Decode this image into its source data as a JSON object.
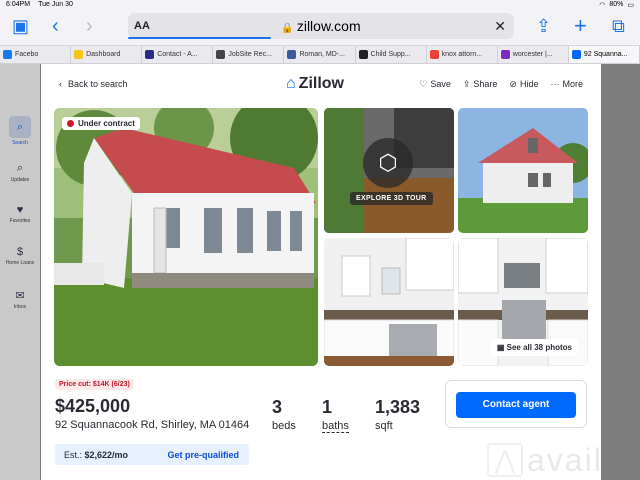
{
  "status_bar": {
    "time": "6:04PM",
    "date": "Tue Jun 30",
    "battery": "80%"
  },
  "browser": {
    "reader_label": "AA",
    "url": "zillow.com",
    "load_progress": 0.37,
    "tabs": [
      {
        "label": "Facebo",
        "color": "#1877f2"
      },
      {
        "label": "Dashboard",
        "color": "#f5c518"
      },
      {
        "label": "Contact - A...",
        "color": "#2a2a8a"
      },
      {
        "label": "JobSite Rec...",
        "color": "#444444"
      },
      {
        "label": "Roman, MD-...",
        "color": "#3b5998"
      },
      {
        "label": "Child Supp...",
        "color": "#222222"
      },
      {
        "label": "knox attorn...",
        "color": "#ea4335"
      },
      {
        "label": "worcester |...",
        "color": "#7b2cbf"
      },
      {
        "label": "92 Squanna...",
        "color": "#006aff"
      }
    ]
  },
  "sidebar": {
    "items": [
      {
        "label": "Search",
        "icon": "search-icon"
      },
      {
        "label": "Updates",
        "icon": "updates-icon"
      },
      {
        "label": "Favorites",
        "icon": "heart-icon"
      },
      {
        "label": "Home Loans",
        "icon": "home-loans-icon"
      },
      {
        "label": "Inbox",
        "icon": "inbox-icon"
      }
    ]
  },
  "listing": {
    "back_label": "Back to search",
    "logo_text": "Zillow",
    "actions": {
      "save": "Save",
      "share": "Share",
      "hide": "Hide",
      "more": "More"
    },
    "status_badge": "Under contract",
    "tour_label": "EXPLORE 3D TOUR",
    "see_all": "See all 38 photos",
    "price_cut": "Price cut: $14K (6/23)",
    "price": "$425,000",
    "address": "92 Squannacook Rd, Shirley, MA 01464",
    "beds_value": "3",
    "beds_label": "beds",
    "baths_value": "1",
    "baths_label": "baths",
    "sqft_value": "1,383",
    "sqft_label": "sqft",
    "est_label": "Est.:",
    "est_value": "$2,622/mo",
    "prequal": "Get pre-qualified",
    "contact_agent": "Contact agent"
  },
  "watermark": "avail",
  "colors": {
    "brand": "#006aff",
    "alert": "#d1162c"
  }
}
